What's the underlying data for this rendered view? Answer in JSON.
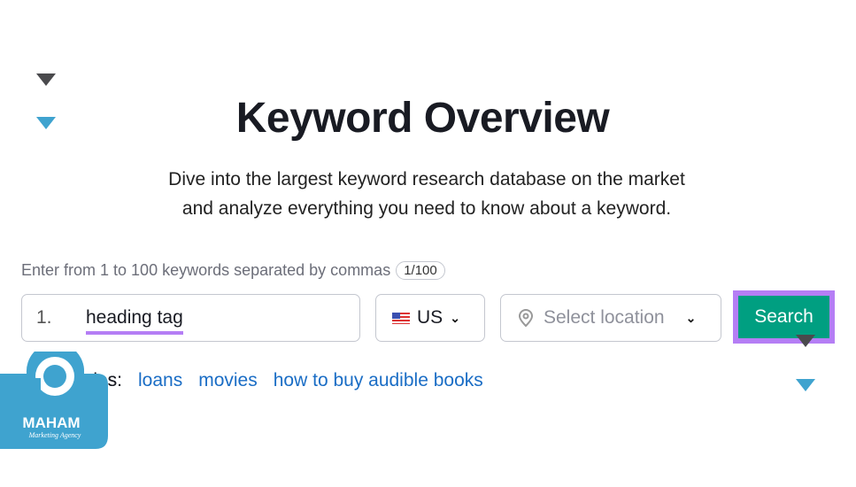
{
  "header": {
    "title": "Keyword Overview",
    "subtitle_line1": "Dive into the largest keyword research database on the market",
    "subtitle_line2": "and analyze everything you need to know about a keyword."
  },
  "form": {
    "hint": "Enter from 1 to 100 keywords separated by commas",
    "counter": "1/100",
    "keyword_index": "1.",
    "keyword_value": "heading tag",
    "country": "US",
    "location_placeholder": "Select location",
    "search_label": "Search"
  },
  "examples": {
    "label": "Examples:",
    "label_visible": "es:",
    "items": [
      "loans",
      "movies",
      "how to buy audible books"
    ]
  },
  "logo": {
    "name": "MAHAM",
    "tagline": "Marketing Agency"
  },
  "colors": {
    "search": "#009f81",
    "highlight": "#b57ef5",
    "link": "#1a6dc5",
    "logo": "#3fa3cf"
  }
}
